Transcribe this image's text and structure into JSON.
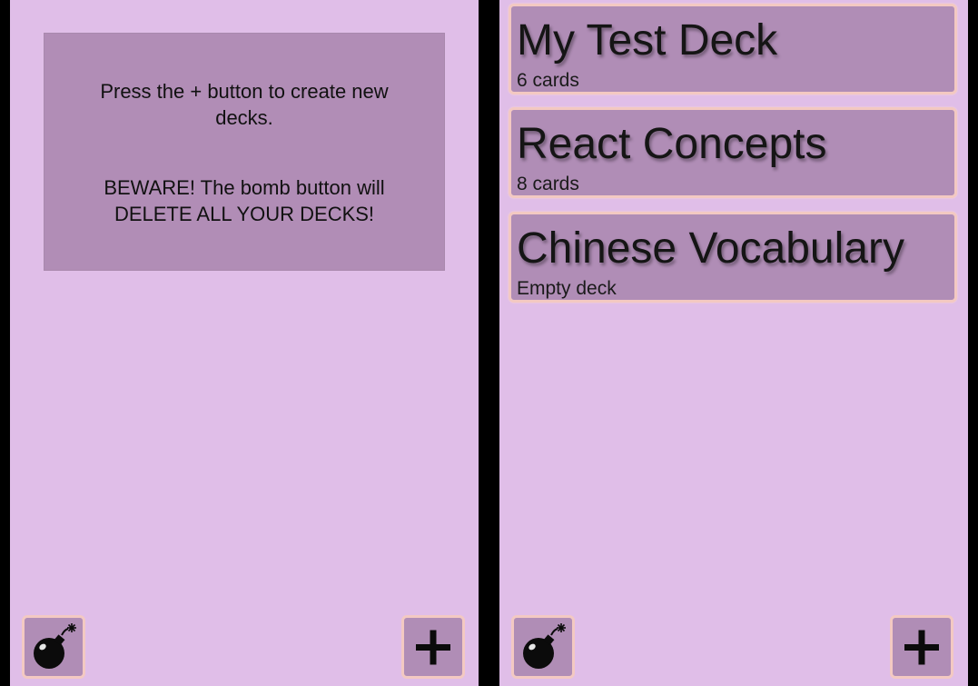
{
  "colors": {
    "screen_bg": "#e0bee8",
    "panel_bg": "#b08db6",
    "button_border": "#f3c9c2",
    "frame_bg": "#000000"
  },
  "left_screen": {
    "info": {
      "line1": "Press the + button to create new decks.",
      "line2": "BEWARE! The bomb button will DELETE ALL YOUR DECKS!"
    },
    "bomb_icon": "bomb-icon",
    "add_icon": "plus-icon"
  },
  "right_screen": {
    "decks": [
      {
        "title": "My Test Deck",
        "count": "6 cards"
      },
      {
        "title": "React Concepts",
        "count": "8 cards"
      },
      {
        "title": "Chinese Vocabulary",
        "count": "Empty deck"
      }
    ],
    "bomb_icon": "bomb-icon",
    "add_icon": "plus-icon"
  }
}
